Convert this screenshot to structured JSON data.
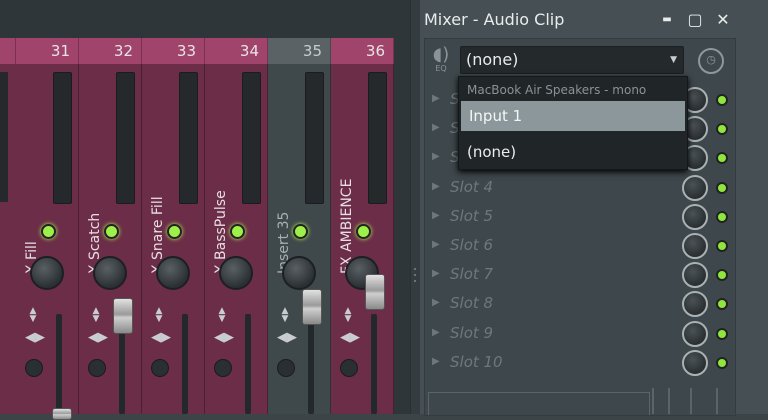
{
  "window": {
    "title": "Mixer - Audio Clip",
    "minimize": "▬",
    "maximize": "▢",
    "close": "✕"
  },
  "strips": [
    {
      "number": "31",
      "name": "X Fill",
      "grey": false
    },
    {
      "number": "32",
      "name": "X Scatch",
      "grey": false
    },
    {
      "number": "33",
      "name": "X Snare Fill",
      "grey": false
    },
    {
      "number": "34",
      "name": "X BassPulse",
      "grey": false
    },
    {
      "number": "35",
      "name": "Insert 35",
      "grey": true
    },
    {
      "number": "36",
      "name": "FX AMBIENCE",
      "grey": false
    }
  ],
  "eq": {
    "label": "EQ"
  },
  "input_select": {
    "value": "(none)"
  },
  "dropdown": {
    "header": "MacBook Air Speakers - mono",
    "options": [
      "Input 1",
      "(none)"
    ],
    "highlighted": "Input 1"
  },
  "slots": [
    "Slot 1",
    "Slot 2",
    "Slot 3",
    "Slot 4",
    "Slot 5",
    "Slot 6",
    "Slot 7",
    "Slot 8",
    "Slot 9",
    "Slot 10"
  ],
  "colors": {
    "strip": "#6b2d48",
    "header": "#a0446b",
    "led": "#9df04a",
    "panel": "#3e474b"
  }
}
